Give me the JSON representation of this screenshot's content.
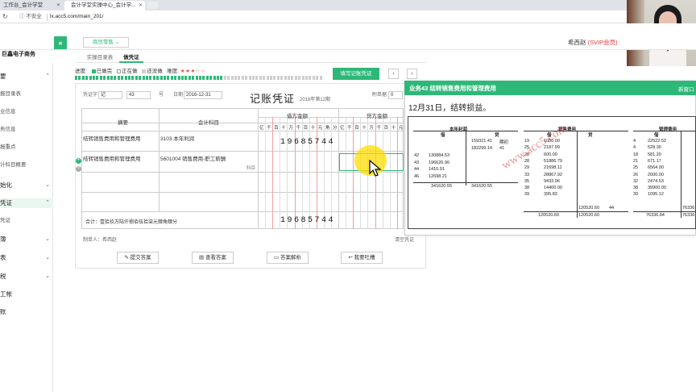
{
  "browser": {
    "tabs": [
      "工作台_会计学堂",
      "会计学堂实操中心_会计学..."
    ],
    "security": "不安全",
    "url": "lx.acc5.com/main_201/"
  },
  "header": {
    "collapse_glyph": "«",
    "brand": "巨鑫电子商务",
    "mode": "商贸零售",
    "user": "希西赵",
    "vip": "(SVIP会员)"
  },
  "sidebar": [
    {
      "label": "要",
      "chev": "^",
      "sub": false
    },
    {
      "label": "报目录表",
      "chev": "",
      "sub": true
    },
    {
      "label": "业信息",
      "chev": "",
      "sub": true
    },
    {
      "label": "务信息",
      "chev": "",
      "sub": true
    },
    {
      "label": "报重点",
      "chev": "",
      "sub": true
    },
    {
      "label": "计科目概要",
      "chev": "",
      "sub": true
    },
    {
      "label": "始化",
      "chev": "v",
      "sub": false
    },
    {
      "label": "凭证",
      "chev": "^",
      "sub": false
    },
    {
      "label": "凭证",
      "chev": "",
      "sub": true
    },
    {
      "label": "簿",
      "chev": "v",
      "sub": false
    },
    {
      "label": "表",
      "chev": "v",
      "sub": false
    },
    {
      "label": "税",
      "chev": "v",
      "sub": false
    },
    {
      "label": "工帐",
      "chev": "",
      "sub": false
    },
    {
      "label": "账",
      "chev": "",
      "sub": false
    }
  ],
  "content_tabs": [
    "实操目录表",
    "做凭证"
  ],
  "progress": {
    "label": "进度:",
    "done": "已做完",
    "doing": "正在做",
    "todo": "还没做",
    "difficulty_label": "难度:",
    "difficulty_stars": "★★★☆☆",
    "done_color": "#2eb878",
    "todo_color": "#cfcfcf"
  },
  "buttons": {
    "fill_voucher": "填写记账凭证",
    "prev": "‹",
    "next": "›"
  },
  "voucher": {
    "word_label": "凭证字",
    "word_value": "记",
    "number": "43",
    "number_suffix": "号",
    "date_label": "日期",
    "date_value": "2016-12-31",
    "title": "记账凭证",
    "period": "2016年第12期",
    "attach_label": "附单据",
    "attach_value": "0",
    "col_summary": "摘要",
    "col_account": "会计科目",
    "col_debit": "借方金额",
    "col_credit": "贷方金额",
    "digit_units": [
      "亿",
      "千",
      "百",
      "十",
      "万",
      "千",
      "百",
      "十",
      "元",
      "角",
      "分"
    ],
    "rows": [
      {
        "summary": "结转销售费用和管理费用",
        "account": "3103 本年利润",
        "account_extra": "",
        "debit": "19685744",
        "credit": ""
      },
      {
        "summary": "结转销售费用和管理费用",
        "account": "5601004 销售费用-职工薪酬",
        "account_extra": "科目",
        "debit": "",
        "credit": ""
      }
    ],
    "total_label": "合计：壹拾玖万陆仟捌佰伍拾柒元肆角肆分",
    "total_debit": "19685744",
    "maker": "制单人：希西赵",
    "clear": "清空凭证"
  },
  "actions": [
    "提交答案",
    "查看答案",
    "答案解析",
    "我要吐槽"
  ],
  "task": {
    "title": "业务43 结转销售费用和管理费用",
    "right_text": "新窗口",
    "subtitle": "12月31日，结转损益。",
    "watermark": "www.acc5.com",
    "ledgers": {
      "profit": {
        "title": "本年利润",
        "debit_label": "借",
        "credit_label": "贷",
        "credit_rows": [
          {
            "n": "",
            "v": "159321.41",
            "note": "期初"
          },
          {
            "n": "41",
            "v": "182299.14",
            "note": ""
          }
        ],
        "debit_rows": [
          {
            "n": "42",
            "v": "130884.53"
          },
          {
            "n": "43",
            "v": "196626.90"
          },
          {
            "n": "44",
            "v": "1410.91"
          },
          {
            "n": "46",
            "v": "12698.21"
          }
        ],
        "total_debit": "341620.55",
        "total_credit": "341620.55"
      },
      "selling": {
        "title": "销售费用",
        "debit_label": "借",
        "credit_label": "贷",
        "rows": [
          {
            "n": "19",
            "v": "1050.00"
          },
          {
            "n": "25",
            "v": "2187.99"
          },
          {
            "n": "26",
            "v": "600.00"
          },
          {
            "n": "28",
            "v": "51886.79"
          },
          {
            "n": "29",
            "v": "21698.11"
          },
          {
            "n": "33",
            "v": "28867.92"
          },
          {
            "n": "35",
            "v": "9433.96"
          },
          {
            "n": "38",
            "v": "14400.00"
          },
          {
            "n": "39",
            "v": "395.83"
          }
        ],
        "credit_entry": "120520.60",
        "credit_entry_no": "44",
        "total_debit": "120520.60",
        "total_credit": "120520.60"
      },
      "admin": {
        "title": "管理费用",
        "debit_label": "借",
        "credit_label": "贷",
        "rows": [
          {
            "n": "4",
            "v": "22522.52"
          },
          {
            "n": "4",
            "v": "528.30"
          },
          {
            "n": "18",
            "v": "581.20"
          },
          {
            "n": "21",
            "v": "671.17"
          },
          {
            "n": "25",
            "v": "6564.00"
          },
          {
            "n": "26",
            "v": "2000.00"
          },
          {
            "n": "32",
            "v": "2474.53"
          },
          {
            "n": "38",
            "v": "39900.00"
          },
          {
            "n": "39",
            "v": "1095.12"
          }
        ],
        "credit_entry": "76336",
        "total_debit": "76336.84",
        "total_credit": "76336"
      }
    }
  }
}
